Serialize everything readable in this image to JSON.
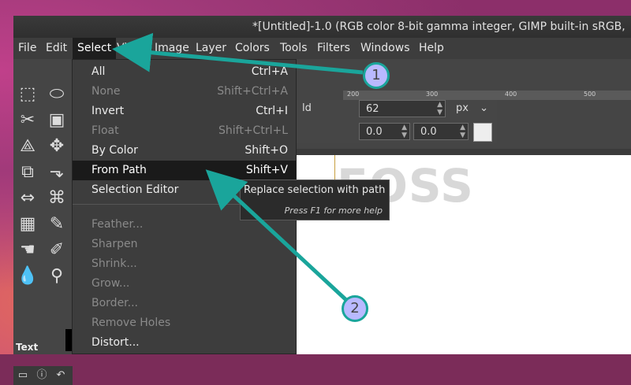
{
  "window": {
    "title": "*[Untitled]-1.0 (RGB color 8-bit gamma integer, GIMP built-in sRGB,"
  },
  "menubar": [
    "File",
    "Edit",
    "Select",
    "View",
    "Image",
    "Layer",
    "Colors",
    "Tools",
    "Filters",
    "Windows",
    "Help"
  ],
  "select_menu": {
    "items": [
      {
        "label": "All",
        "shortcut": "Ctrl+A",
        "enabled": true
      },
      {
        "label": "None",
        "shortcut": "Shift+Ctrl+A",
        "enabled": false
      },
      {
        "label": "Invert",
        "shortcut": "Ctrl+I",
        "enabled": true
      },
      {
        "label": "Float",
        "shortcut": "Shift+Ctrl+L",
        "enabled": false
      },
      {
        "label": "By Color",
        "shortcut": "Shift+O",
        "enabled": true
      },
      {
        "label": "From Path",
        "shortcut": "Shift+V",
        "enabled": true,
        "highlighted": true
      },
      {
        "label": "Selection Editor",
        "shortcut": "",
        "enabled": true
      },
      {
        "label": "Feather...",
        "shortcut": "",
        "enabled": false
      },
      {
        "label": "Sharpen",
        "shortcut": "",
        "enabled": false
      },
      {
        "label": "Shrink...",
        "shortcut": "",
        "enabled": false
      },
      {
        "label": "Grow...",
        "shortcut": "",
        "enabled": false
      },
      {
        "label": "Border...",
        "shortcut": "",
        "enabled": false
      },
      {
        "label": "Remove Holes",
        "shortcut": "",
        "enabled": false
      },
      {
        "label": "Distort...",
        "shortcut": "",
        "enabled": true
      }
    ]
  },
  "tooltip": {
    "text": "Replace selection with path",
    "help": "Press F1 for more help"
  },
  "tool_options": {
    "font_size": "62",
    "unit": "px",
    "field_a": "0.0",
    "field_b": "0.0",
    "partial_label": "ld"
  },
  "ruler": [
    "200",
    "300",
    "400",
    "500"
  ],
  "canvas": {
    "text": "FOSS"
  },
  "toolbox": {
    "bottom_label": "Text"
  },
  "callouts": [
    "1",
    "2"
  ],
  "colors": {
    "accent": "#1aa59b",
    "callout_fill": "#b9b9ff",
    "menu_bg": "#3d3d3d",
    "highlight": "#1a1a1a"
  },
  "icons": {
    "tools": [
      "rect-select-icon",
      "ellipse-select-icon",
      "scissors-icon",
      "foreground-select-icon",
      "path-icon",
      "move-icon",
      "transform-icon",
      "crop-icon",
      "flip-icon",
      "cage-icon",
      "gradient-icon",
      "pencil-icon",
      "smudge-icon",
      "heal-icon",
      "ink-icon",
      "color-picker-icon"
    ]
  }
}
